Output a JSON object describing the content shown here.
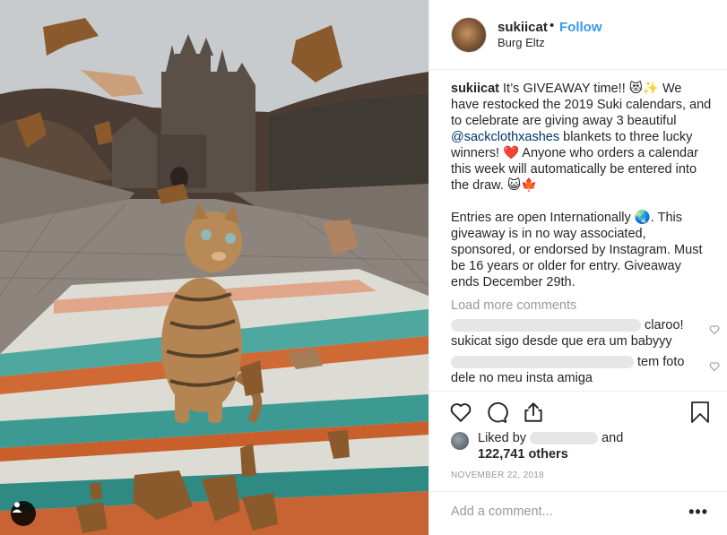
{
  "post": {
    "username": "sukiicat",
    "separator": "•",
    "follow_label": "Follow",
    "location": "Burg Eltz"
  },
  "caption": {
    "username": "sukiicat",
    "part1": " It’s GIVEAWAY time!! 😻✨ We have restocked the 2019 Suki calendars, and to celebrate are giving away 3 beautiful ",
    "mention": "@sackclothxashes",
    "part2": " blankets to three lucky winners! ❤️ Anyone who orders a calendar this week will automatically be entered into the draw. 😺🍁",
    "paragraph2": "Entries are open Internationally 🌏. This giveaway is in no way associated, sponsored, or endorsed by Instagram. Must be 16 years or older for entry. Giveaway ends December 29th."
  },
  "load_more_label": "Load more comments",
  "comments": [
    {
      "tail": " claroo! sukicat sigo desde que era um babyyy"
    },
    {
      "tail": " tem foto dele no meu insta amiga"
    }
  ],
  "likes": {
    "prefix": "Liked by",
    "suffix": "and",
    "count_text": "122,741 others"
  },
  "date": "NOVEMBER 22, 2018",
  "add_comment_placeholder": "Add a comment...",
  "more_label": "•••",
  "icons": {
    "user_tag": "user-tag-icon",
    "like": "heart-icon",
    "comment": "comment-bubble-icon",
    "share": "share-icon",
    "save": "bookmark-icon",
    "comment_like": "small-heart-icon"
  },
  "colors": {
    "follow_blue": "#3897f0",
    "mention_blue": "#003569",
    "muted_gray": "#999999",
    "text": "#262626",
    "divider": "#efefef"
  }
}
